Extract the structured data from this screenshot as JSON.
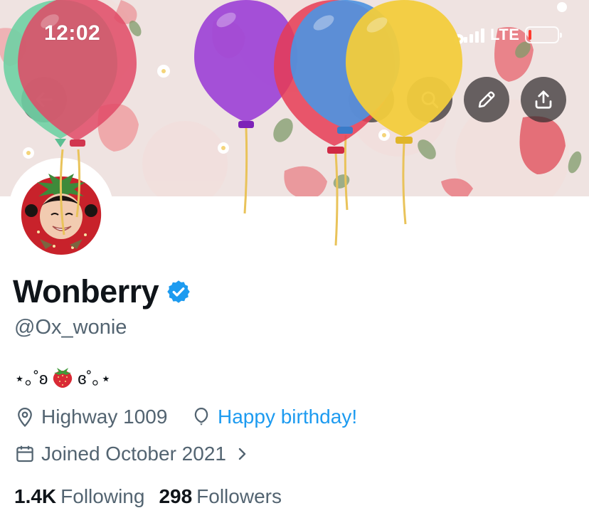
{
  "status_bar": {
    "time": "12:02",
    "network": "LTE",
    "battery_level": 0.1,
    "battery_color": "#ff3b30"
  },
  "header": {
    "actions": [
      {
        "name": "search",
        "icon": "search-icon"
      },
      {
        "name": "edit",
        "icon": "pencil-icon"
      },
      {
        "name": "share",
        "icon": "share-icon"
      }
    ],
    "decoration": "birthday-balloons"
  },
  "profile": {
    "display_name": "Wonberry",
    "verified": true,
    "verified_color": "#1d9bf0",
    "handle": "@Ox_wonie",
    "bio_left": "⋆｡˚ʚ",
    "bio_emoji": "strawberry",
    "bio_right": "ɞ˚｡⋆",
    "location": "Highway 1009",
    "birthday": "Happy birthday!",
    "joined": "Joined October 2021",
    "following_count": "1.4K",
    "following_label": "Following",
    "followers_count": "298",
    "followers_label": "Followers"
  },
  "colors": {
    "link": "#1d9bf0",
    "secondary_text": "#536471",
    "primary_text": "#0f1419"
  }
}
